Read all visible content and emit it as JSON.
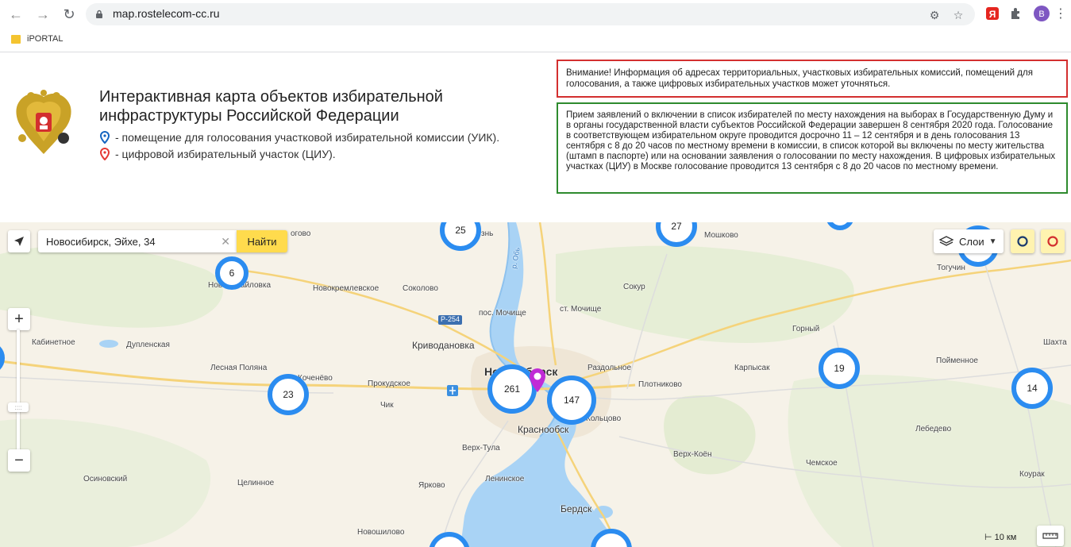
{
  "browser": {
    "url": "map.rostelecom-cc.ru",
    "avatar_letter": "B",
    "bookmark": "iPORTAL"
  },
  "header": {
    "title_line1": "Интерактивная карта объектов избирательной",
    "title_line2": "инфраструктуры Российской Федерации",
    "legend_uik": "- помещение для голосования участковой избирательной комиссии (УИК).",
    "legend_ciu": "- цифровой избирательный участок (ЦИУ).",
    "notice_warning": "Внимание! Информация об адресах территориальных, участковых избирательных комиссий, помещений для голосования, а также цифровых избирательных участков может уточняться.",
    "notice_info": "Прием заявлений о включении в список избирателей по месту нахождения на выборах в Государственную Думу и в органы государственной власти субъектов Российской Федерации завершен 8 сентября 2020 года. Голосование в соответствующем избирательном округе проводится досрочно 11 – 12 сентября и в день голосования 13 сентября с 8 до 20 часов по местному времени в комиссии, в список которой вы включены по месту жительства (штамп в паспорте) или на основании заявления о голосовании по месту нахождения. В цифровых избирательных участках (ЦИУ) в Москве голосование проводится 13 сентября с 8 до 20 часов по местному времени.",
    "colors": {
      "warning_border": "#d32f2f",
      "info_border": "#2e8b2e",
      "cluster": "#2b8cf0",
      "uik_marker": "#1565c0",
      "ciu_marker": "#e53935"
    }
  },
  "map": {
    "search_value": "Новосибирск, Эйхе, 34",
    "find_label": "Найти",
    "layers_label": "Слои",
    "scale_label": "10 км",
    "road_label": "Р-254",
    "clusters": [
      "25",
      "27",
      "6",
      "23",
      "261",
      "147",
      "19",
      "14"
    ],
    "places": {
      "p1": "огово",
      "p2": "знь",
      "p3": "Мошково",
      "p4": "Тогучин",
      "p5": "Новомихайловка",
      "p6": "Новокремлевское",
      "p7": "Соколово",
      "p8": "Сокур",
      "p9": "ст. Мочище",
      "p10": "пос. Мочище",
      "p11": "Горный",
      "p12": "Кабинетное",
      "p13": "Дупленская",
      "p14": "Криводановка",
      "p15": "Шахта",
      "p16": "Пойменное",
      "p17": "Лесная Поляна",
      "p18": "Коченёво",
      "p19": "Прокудское",
      "p20": "Новосибирск",
      "p21": "Раздольное",
      "p22": "Карпысак",
      "p23": "Плотниково",
      "p24": "Чик",
      "p25": "Кольцово",
      "p26": "Краснообск",
      "p27": "Лебедево",
      "p28": "Верх-Тула",
      "p29": "Верх-Коён",
      "p30": "Чемское",
      "p31": "Осиновский",
      "p32": "Целинное",
      "p33": "Ярково",
      "p34": "Ленинское",
      "p35": "Коурак",
      "p36": "Бердск",
      "p37": "Новошилово",
      "p38": "р. Обь"
    }
  }
}
